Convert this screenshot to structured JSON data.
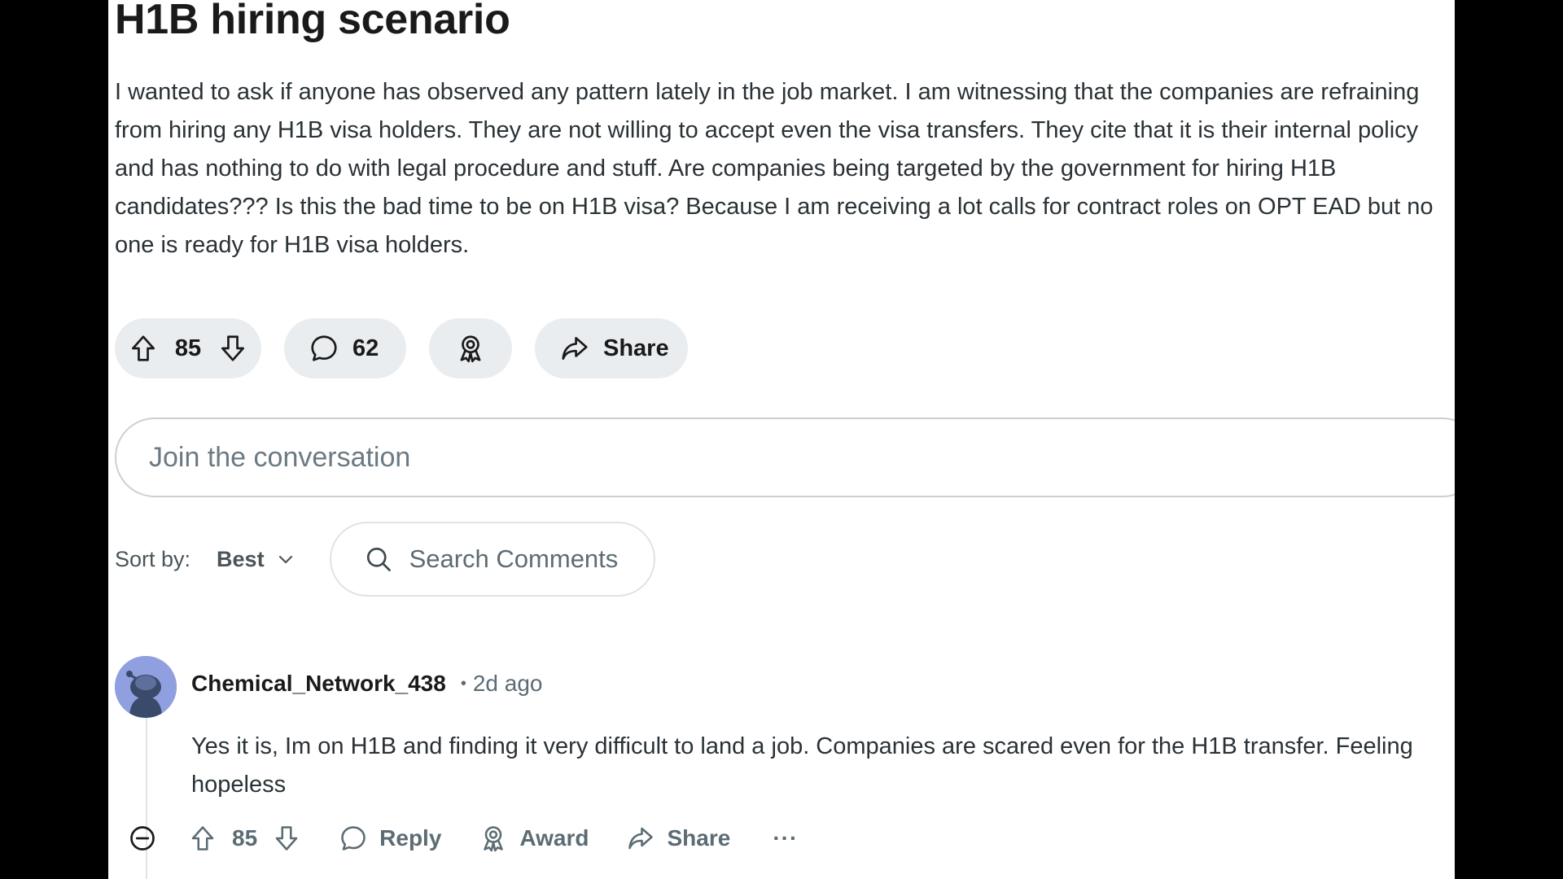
{
  "post": {
    "title": "H1B hiring scenario",
    "body": "I wanted to ask if anyone has observed any pattern lately in the job market. I am witnessing that the companies are refraining from hiring any H1B visa holders. They are not willing to accept even the visa transfers. They cite that it is their internal policy and has nothing to do with legal procedure and stuff. Are companies being targeted by the government for hiring H1B candidates??? Is this the bad time to be on H1B visa? Because I am receiving a lot calls for contract roles on OPT EAD but no one is ready for H1B visa holders.",
    "actions": {
      "vote_count": "85",
      "comment_count": "62",
      "share_label": "Share"
    },
    "icons": {
      "upvote": "upvote-arrow-icon",
      "downvote": "downvote-arrow-icon",
      "comment": "speech-bubble-icon",
      "award": "award-ribbon-icon",
      "share": "share-arrow-icon"
    }
  },
  "composer": {
    "placeholder": "Join the conversation"
  },
  "comments_toolbar": {
    "sort_label": "Sort by:",
    "sort_value": "Best",
    "search_placeholder": "Search Comments"
  },
  "comment": {
    "username": "Chemical_Network_438",
    "separator": "•",
    "time_ago": "2d ago",
    "text": "Yes it is, Im on H1B and finding it very difficult to land a job. Companies are scared even for the H1B transfer. Feeling hopeless",
    "vote_count": "85",
    "reply_label": "Reply",
    "award_label": "Award",
    "share_label": "Share",
    "more_label": "···"
  },
  "colors": {
    "page_background": "#000000",
    "content_background": "#ffffff",
    "pill_background": "#eaedef",
    "avatar_background": "#8f9fe0",
    "text_primary": "#1a1a1b",
    "text_secondary": "#5c6c74"
  }
}
